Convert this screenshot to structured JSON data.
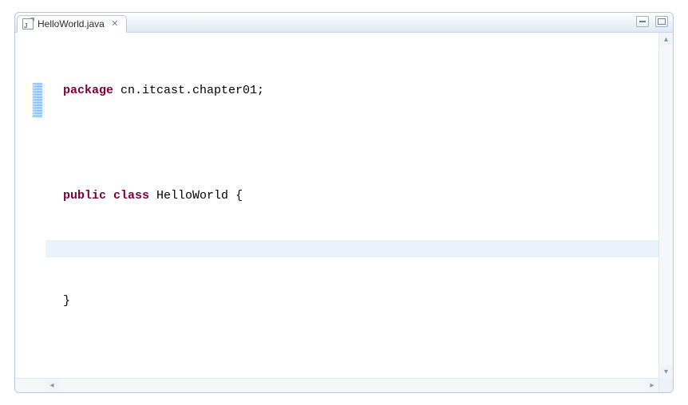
{
  "tab": {
    "filename": "HelloWorld.java",
    "icon_letter": "J"
  },
  "code": {
    "line1": {
      "kw": "package",
      "rest": " cn.itcast.chapter01;"
    },
    "line3": {
      "kw1": "public",
      "kw2": "class",
      "rest": " HelloWorld {"
    },
    "line4_indent_blank": "",
    "line5": "}"
  },
  "glyphs": {
    "close": "✕",
    "tri_up": "▴",
    "tri_down": "▾",
    "tri_left": "◂",
    "tri_right": "▸"
  }
}
